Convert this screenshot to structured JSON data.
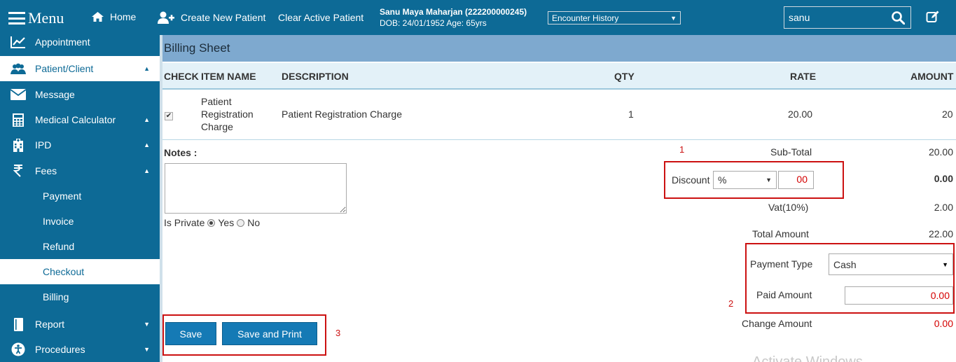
{
  "topbar": {
    "menu_label": "Menu",
    "home_label": "Home",
    "create_patient_label": "Create New Patient",
    "clear_patient_label": "Clear Active Patient",
    "patient_name": "Sanu Maya Maharjan (222200000245)",
    "patient_dob": "DOB: 24/01/1952 Age: 65yrs",
    "encounter_select": "Encounter History",
    "search_value": "sanu",
    "bg_color": "#0d6a96"
  },
  "sidebar": {
    "items": [
      {
        "label": "Appointment",
        "icon": "chart-line-icon"
      },
      {
        "label": "Patient/Client",
        "icon": "users-icon"
      },
      {
        "label": "Message",
        "icon": "envelope-icon"
      },
      {
        "label": "Medical Calculator",
        "icon": "calculator-icon"
      },
      {
        "label": "IPD",
        "icon": "hospital-icon"
      },
      {
        "label": "Fees",
        "icon": "rupee-icon"
      },
      {
        "label": "Report",
        "icon": "book-icon"
      },
      {
        "label": "Procedures",
        "icon": "accessibility-icon"
      }
    ],
    "fees_sub": [
      "Payment",
      "Invoice",
      "Refund",
      "Checkout",
      "Billing"
    ]
  },
  "billing": {
    "title": "Billing Sheet",
    "columns": {
      "check": "CHECK",
      "item": "ITEM NAME",
      "description": "DESCRIPTION",
      "qty": "QTY",
      "rate": "RATE",
      "amount": "AMOUNT"
    },
    "rows": [
      {
        "checked": true,
        "item_lines": [
          "Patient",
          "Registration",
          "Charge"
        ],
        "description": "Patient Registration Charge",
        "qty": "1",
        "rate": "20.00",
        "amount": "20"
      }
    ],
    "notes_label": "Notes :",
    "private_label": "Is Private",
    "private_yes": "Yes",
    "private_no": "No",
    "subtotal_label": "Sub-Total",
    "subtotal_value": "20.00",
    "discount_label": "Discount",
    "discount_type": "%",
    "discount_input": "00",
    "discount_value": "0.00",
    "vat_label": "Vat(10%)",
    "vat_value": "2.00",
    "total_label": "Total Amount",
    "total_value": "22.00",
    "payment_type_label": "Payment Type",
    "payment_type_value": "Cash",
    "paid_amount_label": "Paid Amount",
    "paid_amount_value": "0.00",
    "change_label": "Change Amount",
    "change_value": "0.00",
    "save_label": "Save",
    "save_print_label": "Save and Print"
  },
  "annotations": {
    "one": "1",
    "two": "2",
    "three": "3"
  },
  "watermark": "Activate Windows"
}
